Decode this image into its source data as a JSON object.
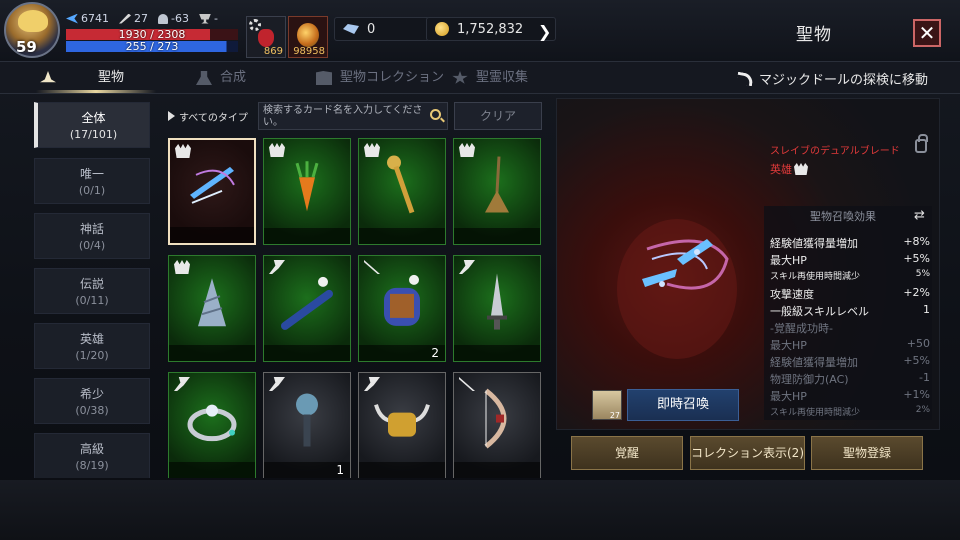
{
  "player": {
    "level": "59",
    "power": "6741",
    "attack": "27",
    "defense": "-63",
    "trophy": "-",
    "hp": "1930 / 2308",
    "mp": "255 / 273"
  },
  "bars": {
    "hp_fraction": 0.836,
    "mp_fraction": 0.934
  },
  "potions": {
    "red": "869",
    "orb": "98958"
  },
  "currency": {
    "crystal": "0",
    "gold": "1,752,832"
  },
  "page_title": "聖物",
  "tabs": [
    {
      "label": "聖物",
      "icon": "hat-icon"
    },
    {
      "label": "合成",
      "icon": "flask-icon"
    },
    {
      "label": "聖物コレクション",
      "icon": "book-icon"
    },
    {
      "label": "聖霊収集",
      "icon": "star-icon"
    }
  ],
  "move_link": "マジックドールの探検に移動",
  "categories": [
    {
      "name": "全体",
      "count": "(17/101)"
    },
    {
      "name": "唯一",
      "count": "(0/1)"
    },
    {
      "name": "神話",
      "count": "(0/4)"
    },
    {
      "name": "伝説",
      "count": "(0/11)"
    },
    {
      "name": "英雄",
      "count": "(1/20)"
    },
    {
      "name": "希少",
      "count": "(0/38)"
    },
    {
      "name": "高級",
      "count": "(8/19)"
    }
  ],
  "filter": {
    "type_label": "すべてのタイプ",
    "search_placeholder": "検索するカード名を入力してください。",
    "clear_label": "クリア"
  },
  "cards": [
    {
      "item": "dual-blade",
      "rank": "hero",
      "tier": "selected",
      "count": ""
    },
    {
      "item": "carrot",
      "rank": "hero",
      "tier": "green",
      "count": ""
    },
    {
      "item": "scepter",
      "rank": "hero",
      "tier": "green",
      "count": ""
    },
    {
      "item": "broom",
      "rank": "hero",
      "tier": "green",
      "count": ""
    },
    {
      "item": "drill",
      "rank": "hero",
      "tier": "green",
      "count": ""
    },
    {
      "item": "bat",
      "rank": "rare",
      "tier": "green",
      "count": ""
    },
    {
      "item": "glove",
      "rank": "bow",
      "tier": "green",
      "count": "2"
    },
    {
      "item": "dagger",
      "rank": "rare",
      "tier": "green",
      "count": ""
    },
    {
      "item": "ring",
      "rank": "rare",
      "tier": "green",
      "count": ""
    },
    {
      "item": "mace",
      "rank": "rare",
      "tier": "white",
      "count": "1"
    },
    {
      "item": "horned-helm",
      "rank": "rare",
      "tier": "white",
      "count": ""
    },
    {
      "item": "bow",
      "rank": "bow",
      "tier": "white",
      "count": ""
    }
  ],
  "detail": {
    "name": "スレイブのデュアルブレード",
    "rank": "英雄",
    "effect_title": "聖物召喚効果",
    "effects": [
      {
        "label": "経験値獲得量増加",
        "value": "+8%",
        "style": "normal"
      },
      {
        "label": "最大HP",
        "value": "+5%",
        "style": "normal"
      },
      {
        "label": "スキル再使用時間減少",
        "value": "5%",
        "style": "small"
      },
      {
        "label": "攻撃速度",
        "value": "+2%",
        "style": "normal"
      },
      {
        "label": "一般級スキルレベル",
        "value": "1",
        "style": "normal"
      },
      {
        "label": "-覚醒成功時-",
        "value": "",
        "style": "dim"
      },
      {
        "label": "最大HP",
        "value": "+50",
        "style": "dim"
      },
      {
        "label": "経験値獲得量増加",
        "value": "+5%",
        "style": "dim"
      },
      {
        "label": "物理防御力(AC)",
        "value": "-1",
        "style": "dim"
      },
      {
        "label": "最大HP",
        "value": "+1%",
        "style": "dim"
      },
      {
        "label": "スキル再使用時間減少",
        "value": "2%",
        "style": "dimsmall"
      }
    ],
    "scroll_count": "27",
    "summon_label": "即時召喚"
  },
  "actions": {
    "awaken": "覚醒",
    "collection": "コレクション表示(2)",
    "register": "聖物登録"
  }
}
